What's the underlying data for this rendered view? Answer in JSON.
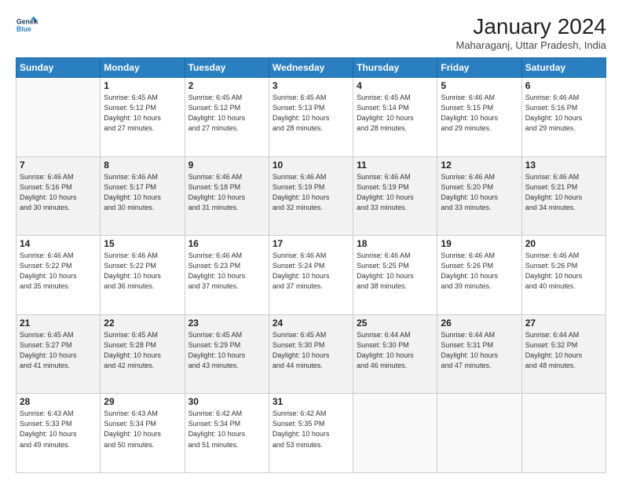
{
  "header": {
    "logo_line1": "General",
    "logo_line2": "Blue",
    "title": "January 2024",
    "subtitle": "Maharaganj, Uttar Pradesh, India"
  },
  "weekdays": [
    "Sunday",
    "Monday",
    "Tuesday",
    "Wednesday",
    "Thursday",
    "Friday",
    "Saturday"
  ],
  "weeks": [
    [
      {
        "day": "",
        "info": ""
      },
      {
        "day": "1",
        "info": "Sunrise: 6:45 AM\nSunset: 5:12 PM\nDaylight: 10 hours\nand 27 minutes."
      },
      {
        "day": "2",
        "info": "Sunrise: 6:45 AM\nSunset: 5:12 PM\nDaylight: 10 hours\nand 27 minutes."
      },
      {
        "day": "3",
        "info": "Sunrise: 6:45 AM\nSunset: 5:13 PM\nDaylight: 10 hours\nand 28 minutes."
      },
      {
        "day": "4",
        "info": "Sunrise: 6:45 AM\nSunset: 5:14 PM\nDaylight: 10 hours\nand 28 minutes."
      },
      {
        "day": "5",
        "info": "Sunrise: 6:46 AM\nSunset: 5:15 PM\nDaylight: 10 hours\nand 29 minutes."
      },
      {
        "day": "6",
        "info": "Sunrise: 6:46 AM\nSunset: 5:16 PM\nDaylight: 10 hours\nand 29 minutes."
      }
    ],
    [
      {
        "day": "7",
        "info": "Sunrise: 6:46 AM\nSunset: 5:16 PM\nDaylight: 10 hours\nand 30 minutes."
      },
      {
        "day": "8",
        "info": "Sunrise: 6:46 AM\nSunset: 5:17 PM\nDaylight: 10 hours\nand 30 minutes."
      },
      {
        "day": "9",
        "info": "Sunrise: 6:46 AM\nSunset: 5:18 PM\nDaylight: 10 hours\nand 31 minutes."
      },
      {
        "day": "10",
        "info": "Sunrise: 6:46 AM\nSunset: 5:19 PM\nDaylight: 10 hours\nand 32 minutes."
      },
      {
        "day": "11",
        "info": "Sunrise: 6:46 AM\nSunset: 5:19 PM\nDaylight: 10 hours\nand 33 minutes."
      },
      {
        "day": "12",
        "info": "Sunrise: 6:46 AM\nSunset: 5:20 PM\nDaylight: 10 hours\nand 33 minutes."
      },
      {
        "day": "13",
        "info": "Sunrise: 6:46 AM\nSunset: 5:21 PM\nDaylight: 10 hours\nand 34 minutes."
      }
    ],
    [
      {
        "day": "14",
        "info": "Sunrise: 6:46 AM\nSunset: 5:22 PM\nDaylight: 10 hours\nand 35 minutes."
      },
      {
        "day": "15",
        "info": "Sunrise: 6:46 AM\nSunset: 5:22 PM\nDaylight: 10 hours\nand 36 minutes."
      },
      {
        "day": "16",
        "info": "Sunrise: 6:46 AM\nSunset: 5:23 PM\nDaylight: 10 hours\nand 37 minutes."
      },
      {
        "day": "17",
        "info": "Sunrise: 6:46 AM\nSunset: 5:24 PM\nDaylight: 10 hours\nand 37 minutes."
      },
      {
        "day": "18",
        "info": "Sunrise: 6:46 AM\nSunset: 5:25 PM\nDaylight: 10 hours\nand 38 minutes."
      },
      {
        "day": "19",
        "info": "Sunrise: 6:46 AM\nSunset: 5:26 PM\nDaylight: 10 hours\nand 39 minutes."
      },
      {
        "day": "20",
        "info": "Sunrise: 6:46 AM\nSunset: 5:26 PM\nDaylight: 10 hours\nand 40 minutes."
      }
    ],
    [
      {
        "day": "21",
        "info": "Sunrise: 6:45 AM\nSunset: 5:27 PM\nDaylight: 10 hours\nand 41 minutes."
      },
      {
        "day": "22",
        "info": "Sunrise: 6:45 AM\nSunset: 5:28 PM\nDaylight: 10 hours\nand 42 minutes."
      },
      {
        "day": "23",
        "info": "Sunrise: 6:45 AM\nSunset: 5:29 PM\nDaylight: 10 hours\nand 43 minutes."
      },
      {
        "day": "24",
        "info": "Sunrise: 6:45 AM\nSunset: 5:30 PM\nDaylight: 10 hours\nand 44 minutes."
      },
      {
        "day": "25",
        "info": "Sunrise: 6:44 AM\nSunset: 5:30 PM\nDaylight: 10 hours\nand 46 minutes."
      },
      {
        "day": "26",
        "info": "Sunrise: 6:44 AM\nSunset: 5:31 PM\nDaylight: 10 hours\nand 47 minutes."
      },
      {
        "day": "27",
        "info": "Sunrise: 6:44 AM\nSunset: 5:32 PM\nDaylight: 10 hours\nand 48 minutes."
      }
    ],
    [
      {
        "day": "28",
        "info": "Sunrise: 6:43 AM\nSunset: 5:33 PM\nDaylight: 10 hours\nand 49 minutes."
      },
      {
        "day": "29",
        "info": "Sunrise: 6:43 AM\nSunset: 5:34 PM\nDaylight: 10 hours\nand 50 minutes."
      },
      {
        "day": "30",
        "info": "Sunrise: 6:42 AM\nSunset: 5:34 PM\nDaylight: 10 hours\nand 51 minutes."
      },
      {
        "day": "31",
        "info": "Sunrise: 6:42 AM\nSunset: 5:35 PM\nDaylight: 10 hours\nand 53 minutes."
      },
      {
        "day": "",
        "info": ""
      },
      {
        "day": "",
        "info": ""
      },
      {
        "day": "",
        "info": ""
      }
    ]
  ]
}
